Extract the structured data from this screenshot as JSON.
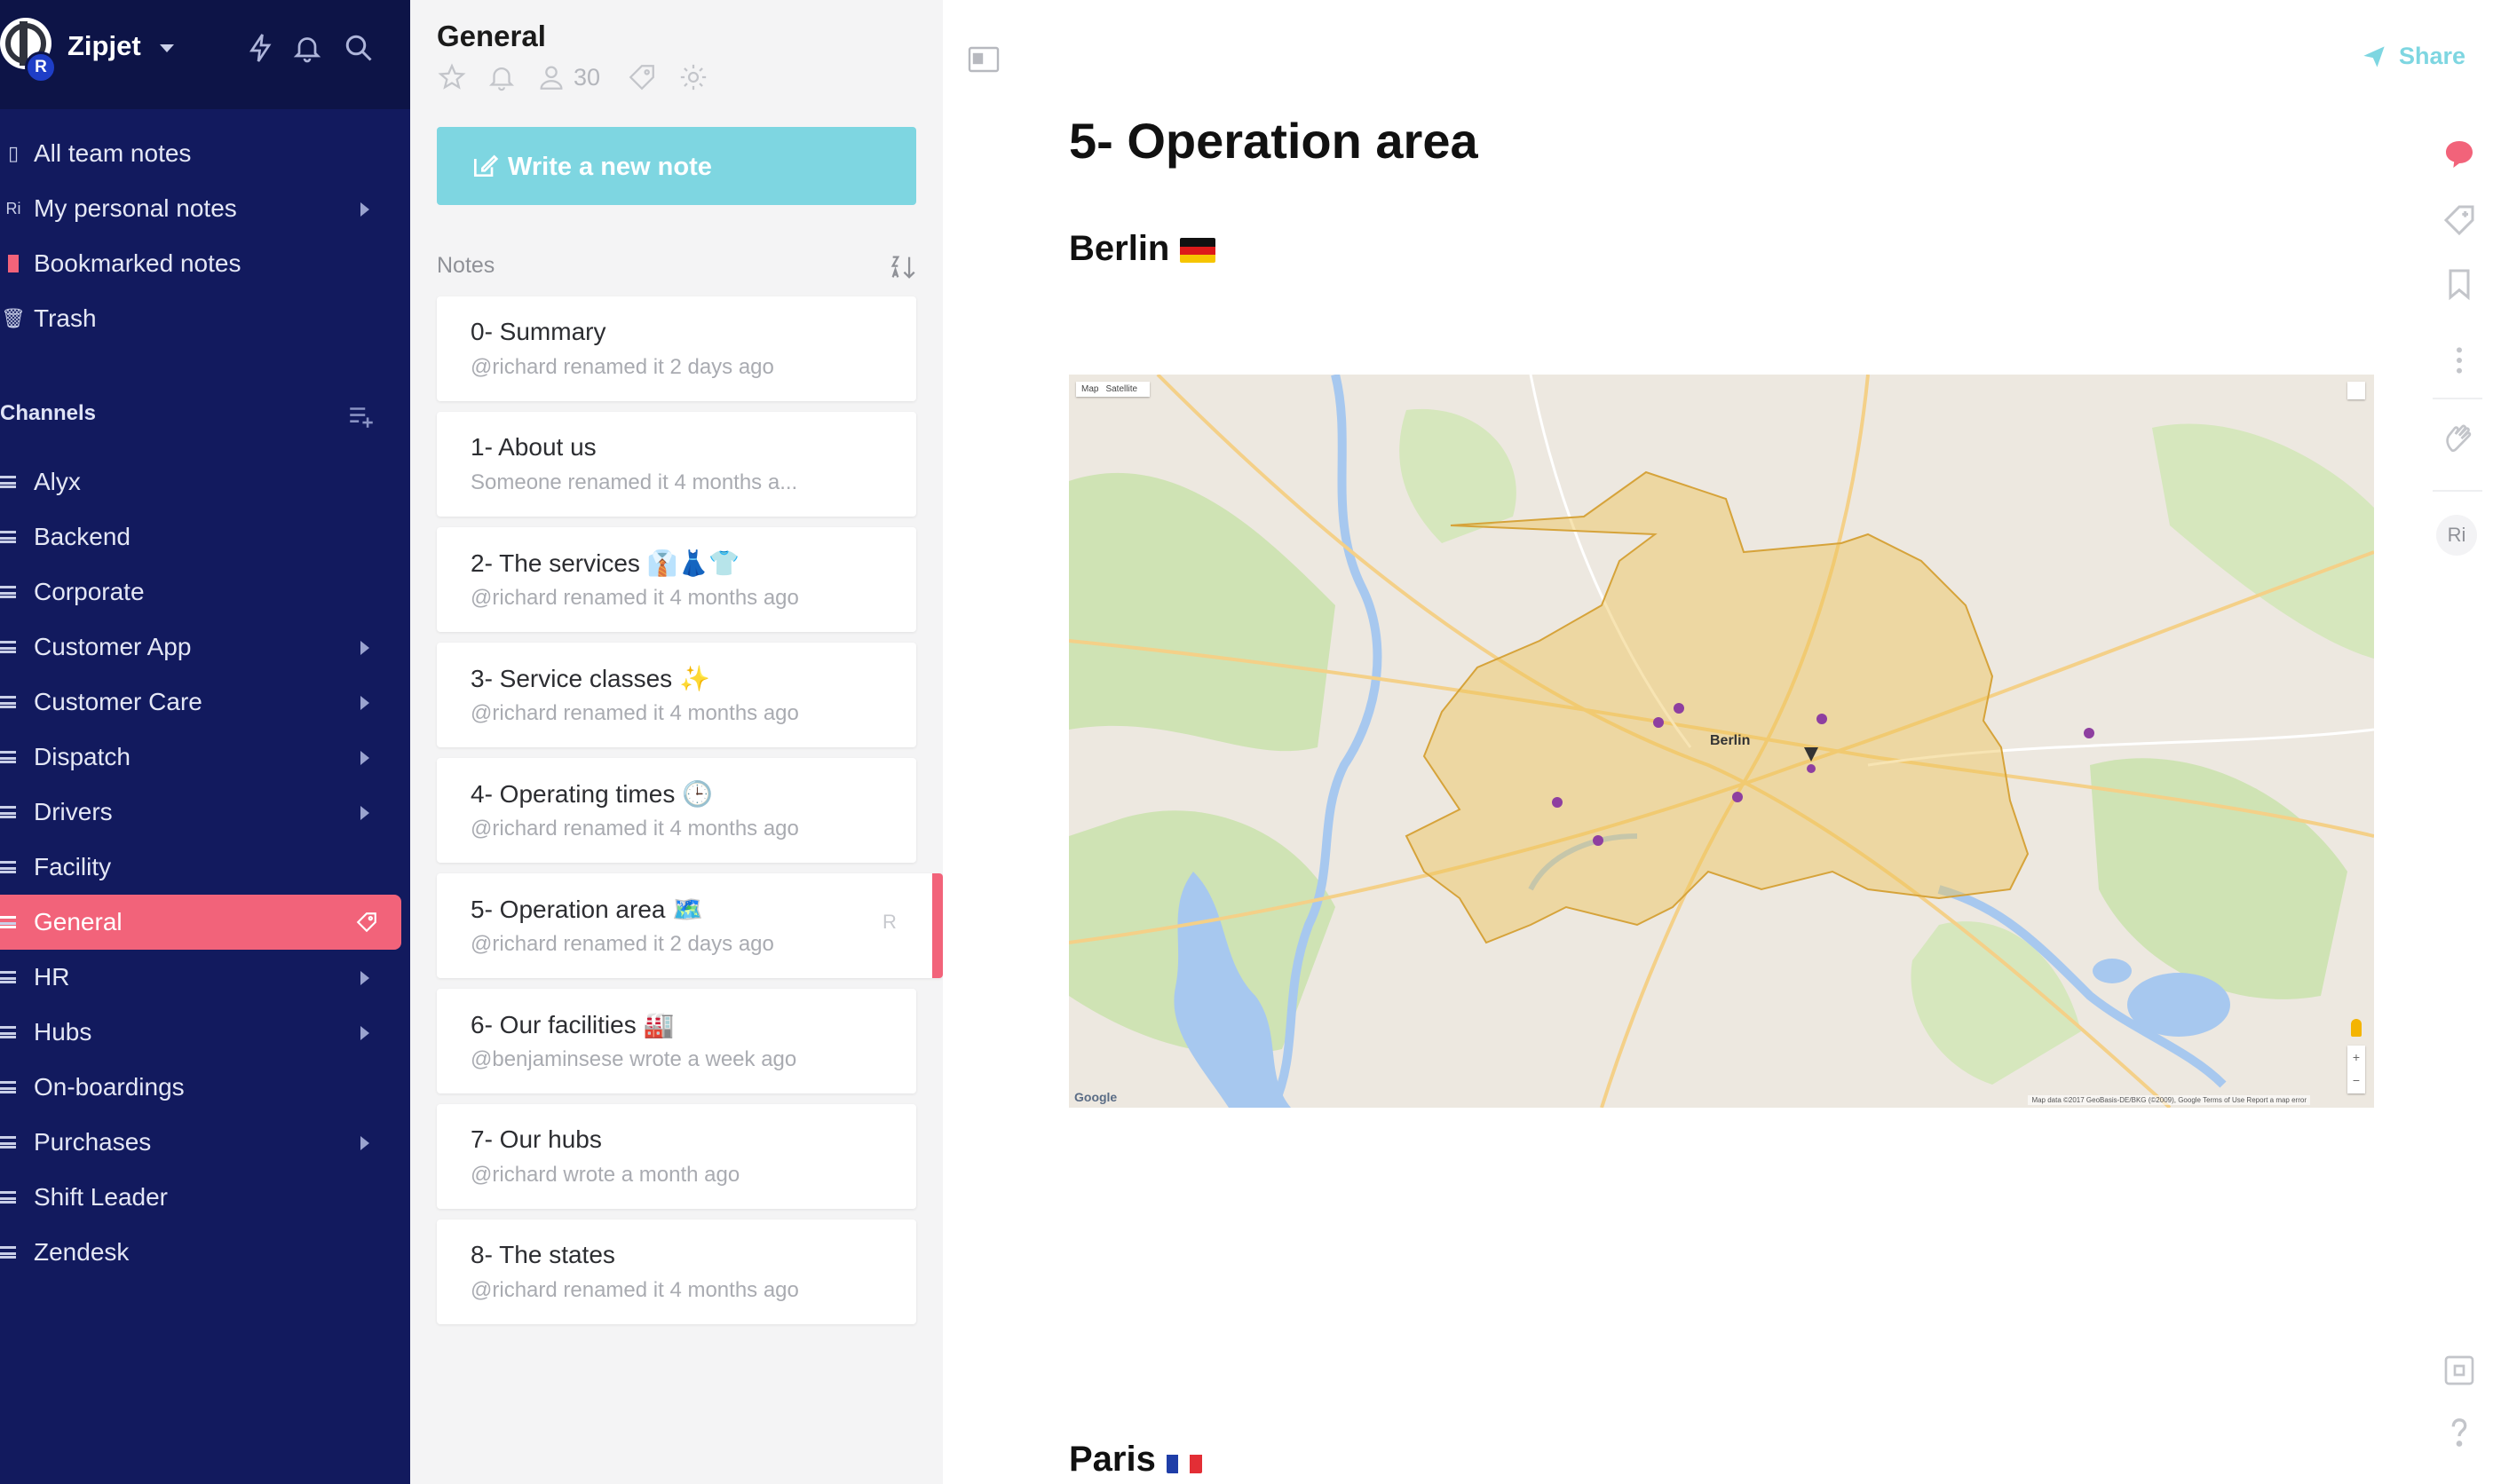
{
  "workspace": {
    "name": "Zipjet",
    "avatar_badge": "R"
  },
  "sidebar": {
    "top_items": [
      {
        "label": "All team notes"
      },
      {
        "label": "My personal notes",
        "icon_text": "Ri"
      },
      {
        "label": "Bookmarked notes"
      },
      {
        "label": "Trash"
      }
    ],
    "channels_heading": "Channels",
    "channels": [
      {
        "label": "Alyx"
      },
      {
        "label": "Backend"
      },
      {
        "label": "Corporate"
      },
      {
        "label": "Customer App"
      },
      {
        "label": "Customer Care"
      },
      {
        "label": "Dispatch"
      },
      {
        "label": "Drivers"
      },
      {
        "label": "Facility"
      },
      {
        "label": "General"
      },
      {
        "label": "HR"
      },
      {
        "label": "Hubs"
      },
      {
        "label": "On-boardings"
      },
      {
        "label": "Purchases"
      },
      {
        "label": "Shift Leader"
      },
      {
        "label": "Zendesk"
      }
    ]
  },
  "notes_panel": {
    "title": "General",
    "member_count": "30",
    "new_note_label": "Write a new note",
    "notes_heading": "Notes",
    "notes": [
      {
        "title": "0- Summary",
        "subtitle": "@richard renamed it 2 days ago"
      },
      {
        "title": "1- About us",
        "subtitle": "Someone renamed it 4 months a..."
      },
      {
        "title": "2- The services 👔👗👕",
        "subtitle": "@richard renamed it 4 months ago"
      },
      {
        "title": "3- Service classes ✨",
        "subtitle": "@richard renamed it 4 months ago"
      },
      {
        "title": "4- Operating times 🕒",
        "subtitle": "@richard renamed it 4 months ago"
      },
      {
        "title": "5- Operation area 🗺️",
        "subtitle": "@richard renamed it 2 days ago",
        "reader": "R"
      },
      {
        "title": "6- Our facilities 🏭",
        "subtitle": "@benjaminsese wrote a week ago"
      },
      {
        "title": "7- Our hubs",
        "subtitle": "@richard wrote a month ago"
      },
      {
        "title": "8- The states",
        "subtitle": "@richard renamed it 4 months ago"
      }
    ]
  },
  "document": {
    "title": "5- Operation area",
    "share_label": "Share",
    "section_berlin": "Berlin",
    "section_paris": "Paris",
    "map": {
      "tab_map": "Map",
      "tab_satellite": "Satellite",
      "city_label": "Berlin",
      "credit": "Google",
      "attribution": "Map data ©2017 GeoBasis-DE/BKG (©2009), Google  Terms of Use  Report a map error"
    },
    "rail_avatar": "Ri"
  },
  "colors": {
    "sidebar_bg": "#121a5e",
    "accent_pink": "#f2637a",
    "accent_teal": "#7ed6e1"
  }
}
